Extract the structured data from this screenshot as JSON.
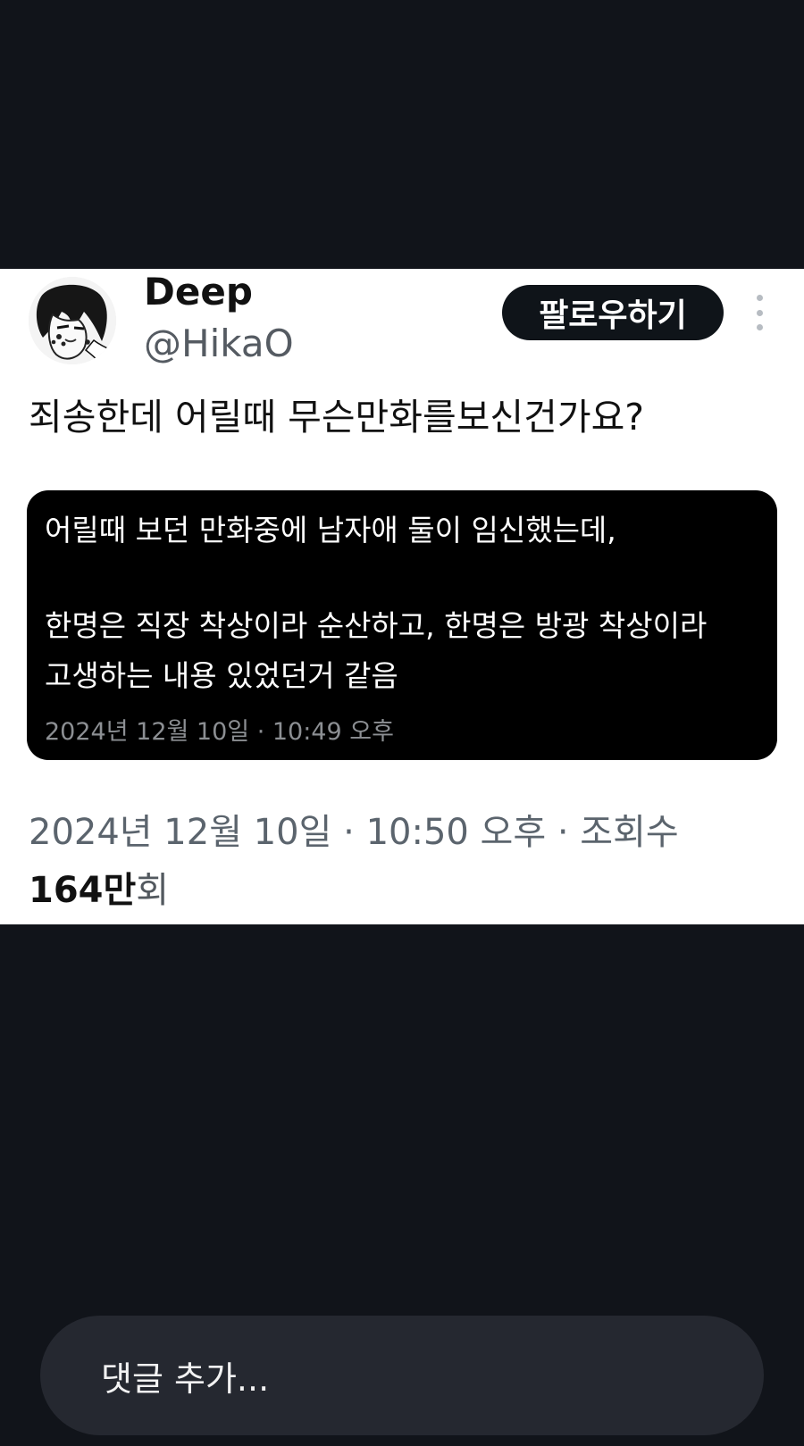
{
  "tweet": {
    "display_name": "Deep",
    "handle": "@HikaO",
    "follow_label": "팔로우하기",
    "text": "죄송한데 어릴때 무슨만화를보신건가요?",
    "quote": {
      "line1": "어릴때 보던 만화중에 남자애 둘이 임신했는데,",
      "line2": "한명은 직장 착상이라 순산하고, 한명은 방광 착상이라",
      "line3": "고생하는 내용 있었던거  같음",
      "timestamp": "2024년 12월 10일 · 10:49 오후"
    },
    "meta": "2024년 12월 10일 · 10:50 오후 · 조회수",
    "views_count": "164만",
    "views_unit": "회"
  },
  "comment": {
    "placeholder": "댓글 추가..."
  },
  "icons": {
    "avatar": "user-avatar",
    "more": "more-options-icon"
  },
  "colors": {
    "background": "#11141a",
    "card": "#ffffff",
    "follow_button": "#0f1419",
    "quote_box": "#000000"
  }
}
